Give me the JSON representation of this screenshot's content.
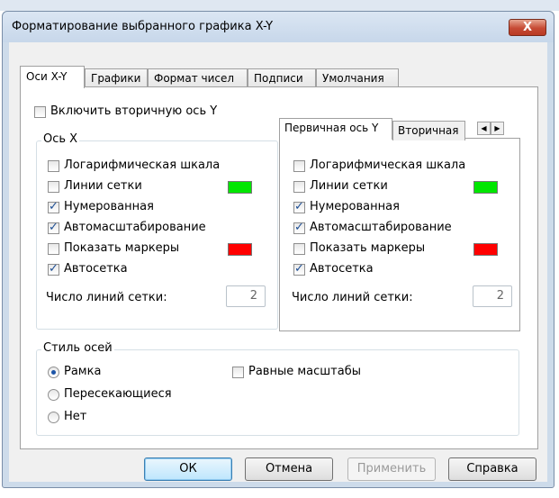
{
  "dialog": {
    "title": "Форматирование выбранного графика X-Y",
    "close_label": "X"
  },
  "tabs": [
    {
      "label": "Оси X-Y",
      "active": true
    },
    {
      "label": "Графики",
      "active": false
    },
    {
      "label": "Формат чисел",
      "active": false
    },
    {
      "label": "Подписи",
      "active": false
    },
    {
      "label": "Умолчания",
      "active": false
    }
  ],
  "secondary_axis": {
    "label": "Включить вторичную ось Y",
    "checked": false
  },
  "x_axis": {
    "legend": "Ось X",
    "options": [
      {
        "label": "Логарифмическая шкала",
        "checked": false
      },
      {
        "label": "Линии сетки",
        "checked": false,
        "color": "#00e600"
      },
      {
        "label": "Нумерованная",
        "checked": true
      },
      {
        "label": "Автомасштабирование",
        "checked": true
      },
      {
        "label": "Показать маркеры",
        "checked": false,
        "color": "#ff0000"
      },
      {
        "label": "Автосетка",
        "checked": true
      }
    ],
    "grid_lines_label": "Число линий сетки:",
    "grid_lines_value": "2"
  },
  "y_axis": {
    "tabs": [
      {
        "label": "Первичная ось Y",
        "active": true
      },
      {
        "label": "Вторичная",
        "active": false
      }
    ],
    "options": [
      {
        "label": "Логарифмическая шкала",
        "checked": false
      },
      {
        "label": "Линии сетки",
        "checked": false,
        "color": "#00e600"
      },
      {
        "label": "Нумерованная",
        "checked": true
      },
      {
        "label": "Автомасштабирование",
        "checked": true
      },
      {
        "label": "Показать маркеры",
        "checked": false,
        "color": "#ff0000"
      },
      {
        "label": "Автосетка",
        "checked": true
      }
    ],
    "grid_lines_label": "Число линий сетки:",
    "grid_lines_value": "2"
  },
  "axis_style": {
    "legend": "Стиль осей",
    "radios": [
      {
        "label": "Рамка",
        "checked": true
      },
      {
        "label": "Пересекающиеся",
        "checked": false
      },
      {
        "label": "Нет",
        "checked": false
      }
    ],
    "equal_scales": {
      "label": "Равные масштабы",
      "checked": false
    }
  },
  "buttons": {
    "ok": "ОК",
    "cancel": "Отмена",
    "apply": "Применить",
    "help": "Справка"
  }
}
